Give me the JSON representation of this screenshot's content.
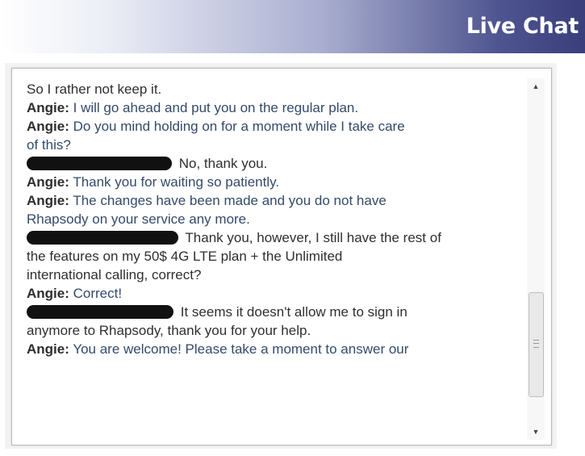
{
  "header": {
    "title": "Live Chat"
  },
  "transcript": [
    {
      "speaker": "",
      "text": "So I rather not keep it."
    },
    {
      "speaker": "Angie:",
      "text": "I will go ahead and put you on the regular plan."
    },
    {
      "speaker": "Angie:",
      "text": "Do you mind holding on for a moment while I take care"
    },
    {
      "speaker": "",
      "text": "of this?"
    },
    {
      "speaker": "[redacted]",
      "text": "No, thank you."
    },
    {
      "speaker": "Angie:",
      "text": "Thank you for waiting so patiently."
    },
    {
      "speaker": "Angie:",
      "text": "The changes have been made and you do not have"
    },
    {
      "speaker": "",
      "text": "Rhapsody on your service any more."
    },
    {
      "speaker": "[redacted]",
      "text": "Thank you, however, I still have the rest of"
    },
    {
      "speaker": "",
      "text": "the features on my 50$ 4G LTE plan + the Unlimited"
    },
    {
      "speaker": "",
      "text": "international calling, correct?"
    },
    {
      "speaker": "Angie:",
      "text": "Correct!"
    },
    {
      "speaker": "[redacted]",
      "text": "It seems it doesn't allow me to sign in"
    },
    {
      "speaker": "",
      "text": "anymore to Rhapsody, thank you for your help."
    },
    {
      "speaker": "Angie:",
      "text": "You are welcome! Please take a moment to answer our"
    }
  ],
  "scrollbar": {
    "up_icon": "▲",
    "down_icon": "▼",
    "position_fraction": 0.85
  },
  "colors": {
    "header_dark": "#3a3f7c",
    "agent_text": "#344a6a"
  }
}
